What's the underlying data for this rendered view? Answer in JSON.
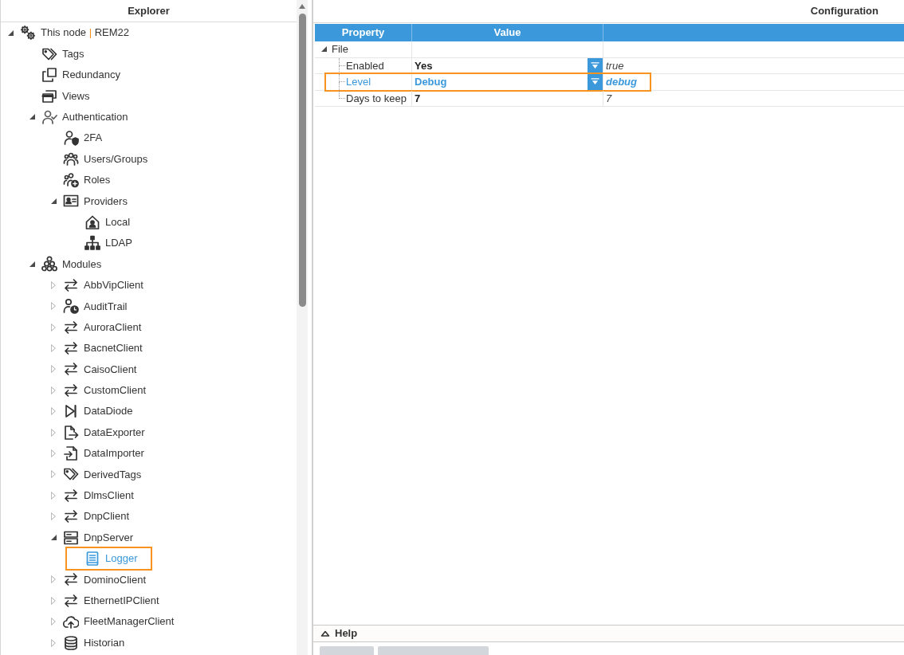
{
  "explorer": {
    "title": "Explorer",
    "tree": [
      {
        "label": "This node",
        "separator": "|",
        "suffix": "REM22",
        "kind": "node",
        "expanded": true,
        "selected": false,
        "children": [
          {
            "label": "Tags",
            "kind": "tags",
            "selected": false
          },
          {
            "label": "Redundancy",
            "kind": "redundancy",
            "selected": false
          },
          {
            "label": "Views",
            "kind": "views",
            "selected": false
          },
          {
            "label": "Authentication",
            "kind": "authentication",
            "expanded": true,
            "selected": false,
            "children": [
              {
                "label": "2FA",
                "kind": "twofactor",
                "selected": false
              },
              {
                "label": "Users/Groups",
                "kind": "users",
                "selected": false
              },
              {
                "label": "Roles",
                "kind": "roles",
                "selected": false
              },
              {
                "label": "Providers",
                "kind": "providers",
                "expanded": true,
                "selected": false,
                "children": [
                  {
                    "label": "Local",
                    "kind": "local",
                    "selected": false
                  },
                  {
                    "label": "LDAP",
                    "kind": "ldap",
                    "selected": false
                  }
                ]
              }
            ]
          },
          {
            "label": "Modules",
            "kind": "modules",
            "expanded": true,
            "selected": false,
            "children": [
              {
                "label": "AbbVipClient",
                "kind": "client",
                "expanded": false,
                "selected": false
              },
              {
                "label": "AuditTrail",
                "kind": "audit",
                "expanded": false,
                "selected": false
              },
              {
                "label": "AuroraClient",
                "kind": "client",
                "expanded": false,
                "selected": false
              },
              {
                "label": "BacnetClient",
                "kind": "client",
                "expanded": false,
                "selected": false
              },
              {
                "label": "CaisoClient",
                "kind": "client",
                "expanded": false,
                "selected": false
              },
              {
                "label": "CustomClient",
                "kind": "client",
                "expanded": false,
                "selected": false
              },
              {
                "label": "DataDiode",
                "kind": "diode",
                "expanded": false,
                "selected": false
              },
              {
                "label": "DataExporter",
                "kind": "exporter",
                "expanded": false,
                "selected": false
              },
              {
                "label": "DataImporter",
                "kind": "importer",
                "expanded": false,
                "selected": false
              },
              {
                "label": "DerivedTags",
                "kind": "derivedtags",
                "expanded": false,
                "selected": false
              },
              {
                "label": "DlmsClient",
                "kind": "client",
                "expanded": false,
                "selected": false
              },
              {
                "label": "DnpClient",
                "kind": "client",
                "expanded": false,
                "selected": false
              },
              {
                "label": "DnpServer",
                "kind": "server",
                "expanded": true,
                "selected": false,
                "children": [
                  {
                    "label": "Logger",
                    "kind": "logger",
                    "selected": true
                  }
                ]
              },
              {
                "label": "DominoClient",
                "kind": "client",
                "expanded": false,
                "selected": false
              },
              {
                "label": "EthernetIPClient",
                "kind": "client",
                "expanded": false,
                "selected": false
              },
              {
                "label": "FleetManagerClient",
                "kind": "cloud",
                "expanded": false,
                "selected": false
              },
              {
                "label": "Historian",
                "kind": "historian",
                "expanded": false,
                "selected": false
              }
            ]
          }
        ]
      }
    ]
  },
  "configuration": {
    "title": "Configuration",
    "columns": [
      "Property",
      "Value"
    ],
    "groups": [
      {
        "name": "File",
        "expanded": true,
        "properties": [
          {
            "name": "Enabled",
            "value": "Yes",
            "column_3": "true",
            "kind": "dropdown",
            "selected": false
          },
          {
            "name": "Level",
            "value": "Debug",
            "column_3": "debug",
            "kind": "dropdown",
            "selected": true
          },
          {
            "name": "Days to keep",
            "value": "7",
            "column_3": "7",
            "kind": "text",
            "selected": false
          }
        ]
      }
    ]
  },
  "help": {
    "label": "Help",
    "expanded": false
  },
  "action_buttons": [
    {
      "disabled": true
    },
    {
      "disabled": true
    }
  ]
}
